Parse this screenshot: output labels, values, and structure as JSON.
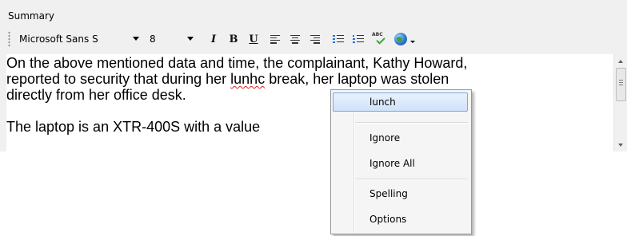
{
  "summary": {
    "title": "Summary"
  },
  "toolbar": {
    "font_name": "Microsoft Sans S",
    "font_size": "8",
    "italic_label": "I",
    "bold_label": "B",
    "underline_label": "U",
    "spell_label": "ABC"
  },
  "editor": {
    "paragraphs": [
      {
        "line1": "On the above mentioned data and time, the complainant, Kathy Howard,",
        "line2_before": "reported to security that during her ",
        "misspelled_word": "lunhc",
        "line2_after": " break, her laptop was stolen",
        "line3": "directly from her office desk."
      },
      {
        "line1": "The laptop is an XTR-400S with a value"
      }
    ]
  },
  "context_menu": {
    "suggestion": "lunch",
    "items": [
      "Ignore",
      "Ignore All",
      "Spelling",
      "Options"
    ]
  },
  "colors": {
    "misspell_underline": "#e02020",
    "menu_highlight_border": "#76a8e2",
    "list_bullet": "#2a6fd6"
  },
  "icons": [
    "italic-icon",
    "bold-icon",
    "underline-icon",
    "align-left-icon",
    "align-center-icon",
    "align-right-icon",
    "bulleted-list-icon",
    "numbered-list-icon",
    "spell-check-icon",
    "globe-icon"
  ]
}
